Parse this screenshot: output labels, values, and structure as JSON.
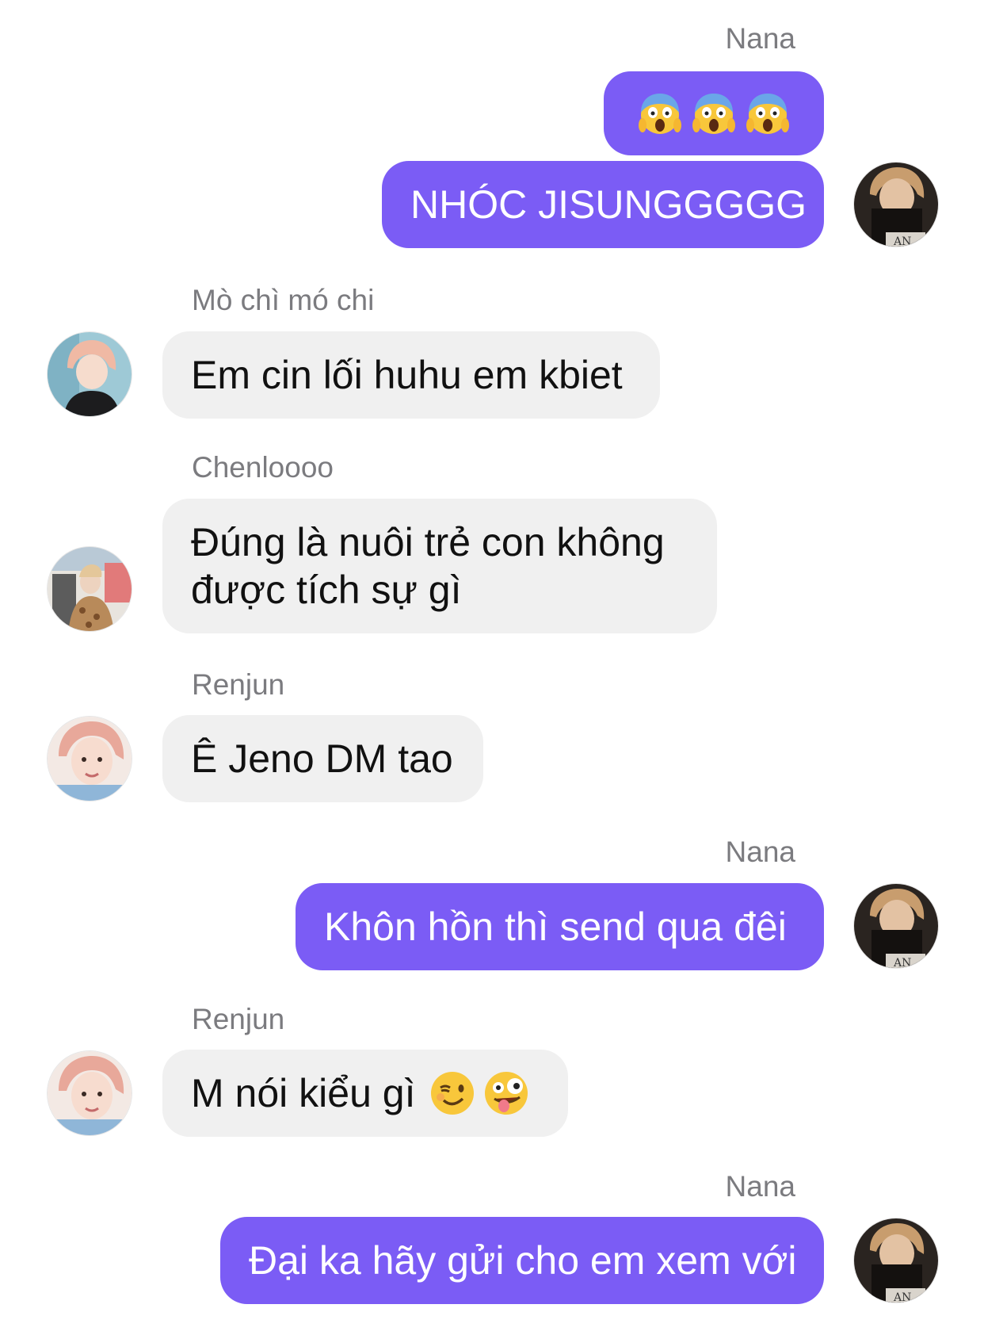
{
  "colors": {
    "outgoing": "#7b5cf5",
    "incoming": "#f0f0f0",
    "sender_label": "#7b7b7f"
  },
  "messages": [
    {
      "sender": "Nana",
      "direction": "out",
      "content": [
        "scream-emoji",
        "scream-emoji",
        "scream-emoji"
      ]
    },
    {
      "sender": "Nana",
      "direction": "out",
      "text": "NHÓC JISUNGGGGG"
    },
    {
      "sender": "Mò chì mó chi",
      "direction": "in",
      "text": "Em cin lối huhu em kbiet"
    },
    {
      "sender": "Chenloooo",
      "direction": "in",
      "text_lines": [
        "Đúng là nuôi trẻ con không",
        "được tích sự gì"
      ]
    },
    {
      "sender": "Renjun",
      "direction": "in",
      "text": "Ê Jeno DM tao"
    },
    {
      "sender": "Nana",
      "direction": "out",
      "text": "Khôn hồn thì send qua đêi"
    },
    {
      "sender": "Renjun",
      "direction": "in",
      "text": "M nói kiểu gì",
      "emojis": [
        "wink-emoji",
        "zany-face-emoji"
      ]
    },
    {
      "sender": "Nana",
      "direction": "out",
      "text": "Đại ka hãy gửi cho em xem với"
    }
  ]
}
